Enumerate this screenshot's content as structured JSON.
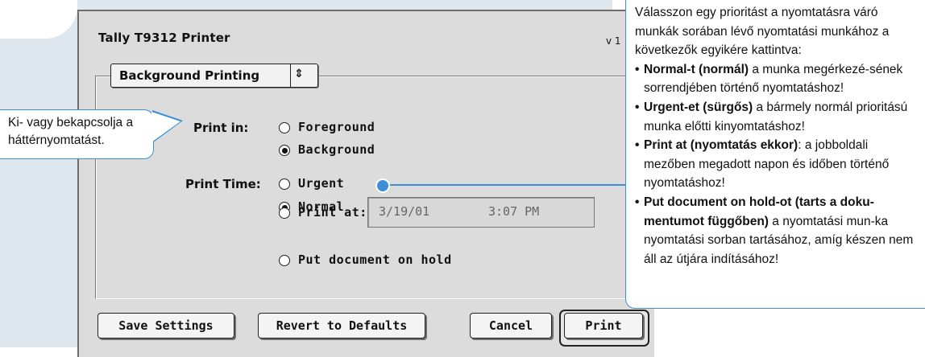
{
  "dialog": {
    "title": "Tally T9312 Printer",
    "version": "v 1",
    "popup_label": "Background Printing",
    "popup_arrow": "⇕"
  },
  "print_in": {
    "label": "Print in:",
    "options": [
      {
        "label": "Foreground",
        "selected": false
      },
      {
        "label": "Background",
        "selected": true
      }
    ]
  },
  "print_time": {
    "label": "Print Time:",
    "options": [
      {
        "label": "Urgent",
        "selected": false
      },
      {
        "label": "Normal",
        "selected": true
      },
      {
        "label": "Print at:",
        "selected": false
      },
      {
        "label": "Put document on hold",
        "selected": false
      }
    ],
    "date": "3/19/01",
    "time": "3:07 PM"
  },
  "buttons": {
    "save": "Save Settings",
    "revert": "Revert to Defaults",
    "cancel": "Cancel",
    "print": "Print"
  },
  "callout_left": {
    "text": "Ki- vagy bekapcsolja a háttérnyomtatást."
  },
  "callout_right": {
    "intro": "Válasszon egy prioritást a nyomtatásra váró munkák sorában lévő nyomtatási munkához a következők egyikére kattintva:",
    "bullet": "•",
    "items": [
      {
        "bold": "Normal-t (normál)",
        "rest": " a munka megérkezé-sének sorrendjében történő nyomtatáshoz!"
      },
      {
        "bold": "Urgent-et (sürgős)",
        "rest": " a bármely normál prioritású munka előtti kinyomtatáshoz!"
      },
      {
        "bold": "Print at (nyomtatás ekkor)",
        "rest": ": a jobboldali mezőben megadott napon és időben történő nyomtatáshoz!"
      },
      {
        "bold": "Put document on hold-ot (tarts a doku-mentumot függőben)",
        "rest": " a nyomtatási mun-ka nyomtatási sorban tartásához, amíg készen nem áll az útjára indításához!"
      }
    ]
  },
  "colors": {
    "accent_blue": "#3c8fd6",
    "side_panel": "#dfe7ef",
    "dialog_gray": "#dcdcdc"
  }
}
